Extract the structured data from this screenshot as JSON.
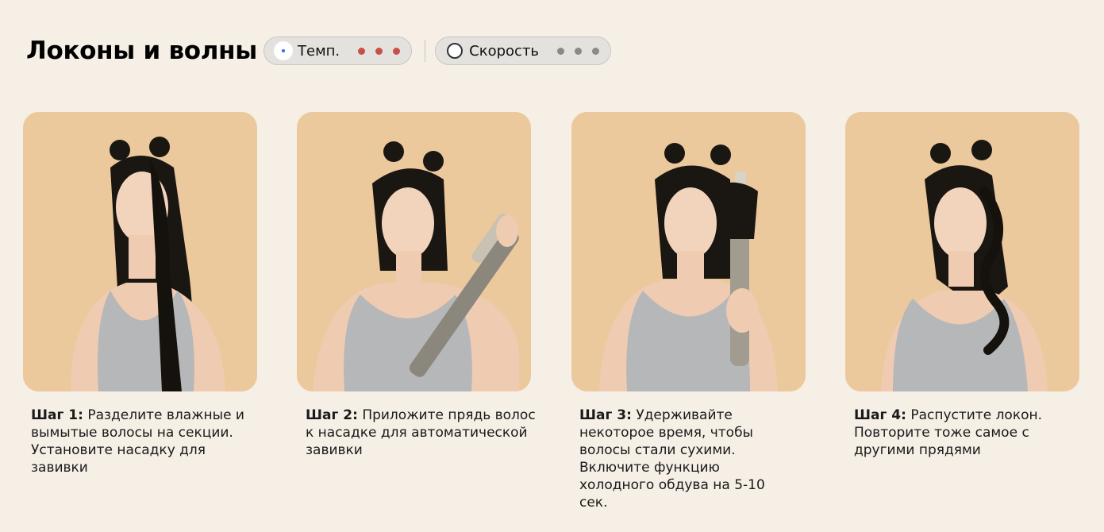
{
  "header": {
    "title": "Локоны и волны",
    "temp_label": "Темп.",
    "speed_label": "Скорость",
    "temp_icon": "temperature-icon",
    "speed_icon": "speed-icon",
    "temp_level": 3,
    "speed_level": 3,
    "temp_dot_color": "#c9504a",
    "speed_dot_color": "#8a8a8a"
  },
  "steps": [
    {
      "label": "Шаг 1:",
      "text": "Разделите влажные и вымытые волосы на секции. Установите насадку для завивки"
    },
    {
      "label": "Шаг 2:",
      "text": "Приложите прядь волос к насадке для автоматической завивки"
    },
    {
      "label": "Шаг 3:",
      "text": "Удерживайте некоторое время, чтобы волосы стали сухими. Включите функцию холодного обдува на 5-10 сек."
    },
    {
      "label": "Шаг 4:",
      "text": "Распустите локон. Повторите тоже самое с другими прядями"
    }
  ]
}
